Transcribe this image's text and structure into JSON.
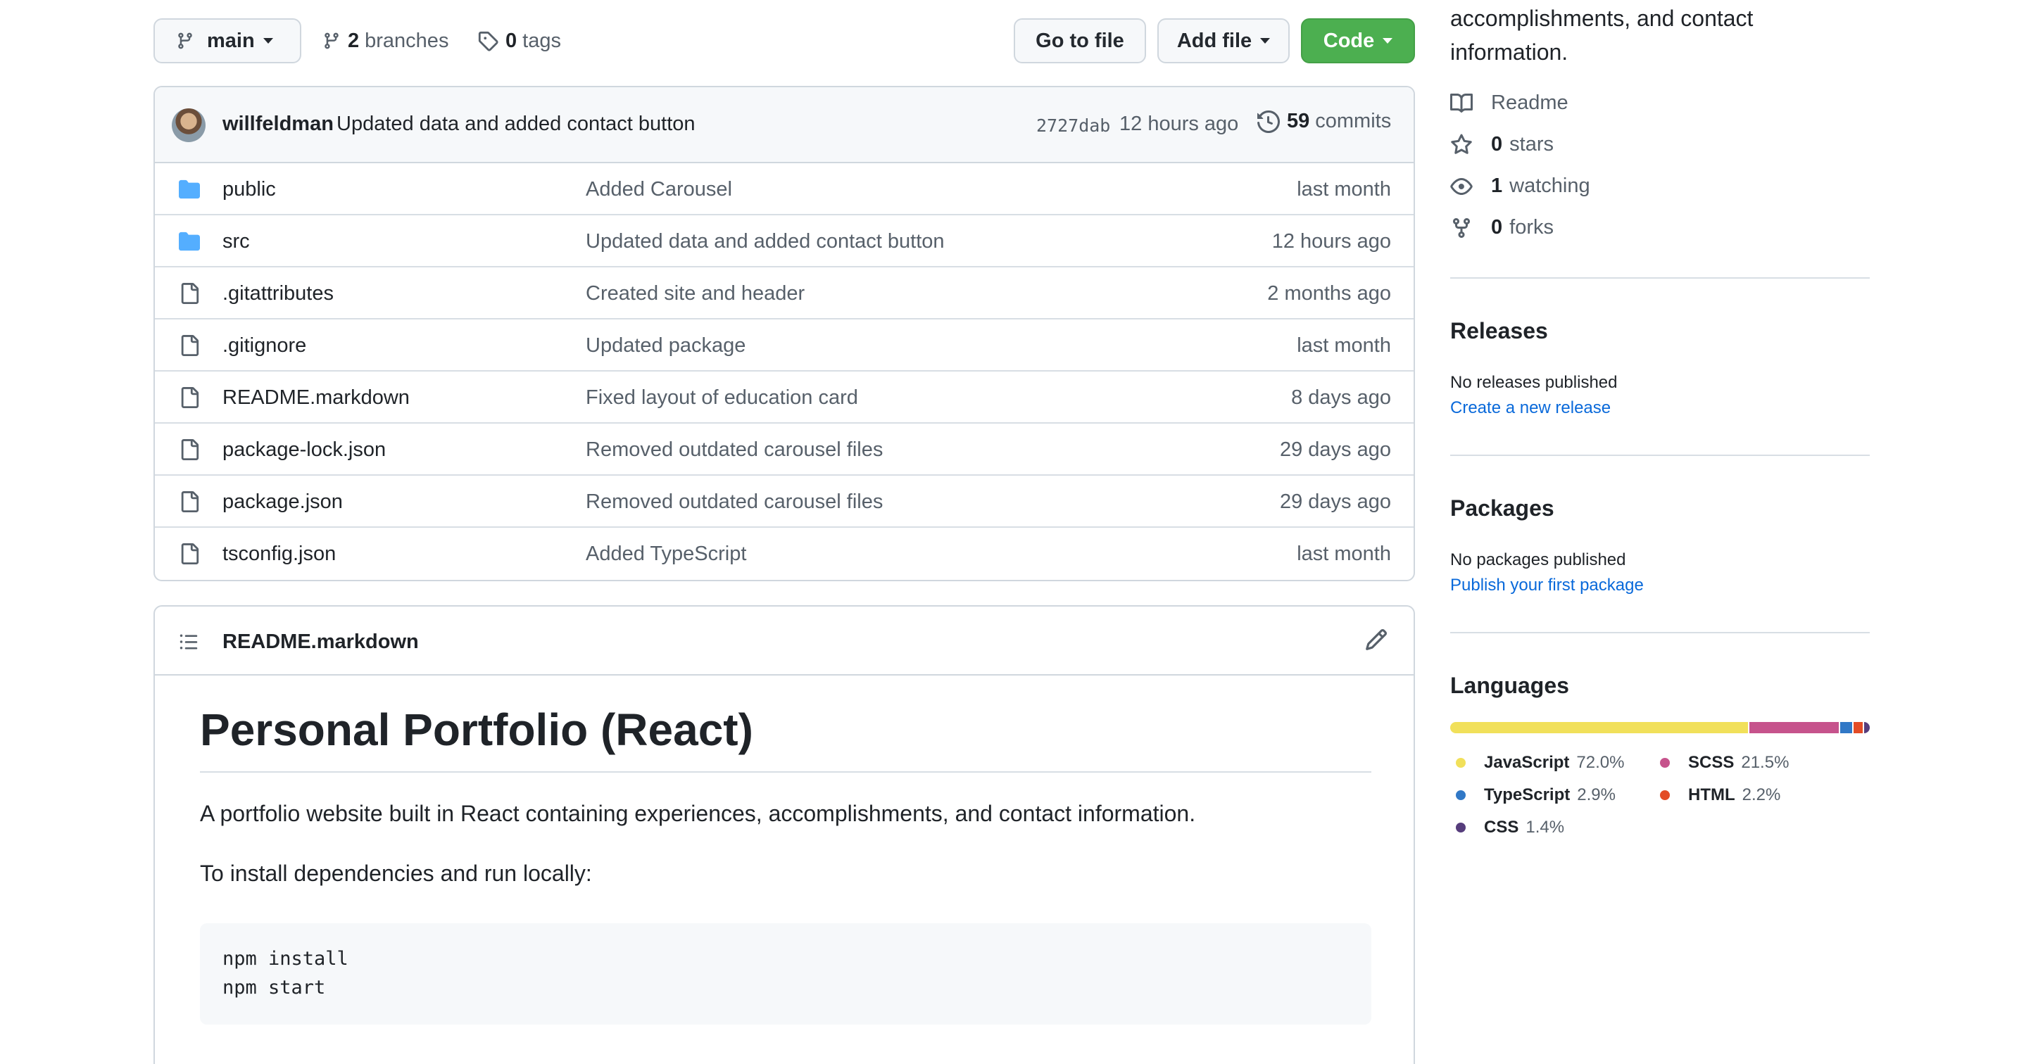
{
  "repo_bar": {
    "branch": "main",
    "branches_count": "2",
    "branches_label": "branches",
    "tags_count": "0",
    "tags_label": "tags",
    "goto_file": "Go to file",
    "add_file": "Add file",
    "code": "Code"
  },
  "latest_commit": {
    "author": "willfeldman",
    "message": "Updated data and added contact button",
    "sha": "2727dab",
    "time": "12 hours ago",
    "count": "59",
    "count_label": "commits"
  },
  "files": [
    {
      "name": "public",
      "type": "folder",
      "message": "Added Carousel",
      "age": "last month"
    },
    {
      "name": "src",
      "type": "folder",
      "message": "Updated data and added contact button",
      "age": "12 hours ago"
    },
    {
      "name": ".gitattributes",
      "type": "file",
      "message": "Created site and header",
      "age": "2 months ago"
    },
    {
      "name": ".gitignore",
      "type": "file",
      "message": "Updated package",
      "age": "last month"
    },
    {
      "name": "README.markdown",
      "type": "file",
      "message": "Fixed layout of education card",
      "age": "8 days ago"
    },
    {
      "name": "package-lock.json",
      "type": "file",
      "message": "Removed outdated carousel files",
      "age": "29 days ago"
    },
    {
      "name": "package.json",
      "type": "file",
      "message": "Removed outdated carousel files",
      "age": "29 days ago"
    },
    {
      "name": "tsconfig.json",
      "type": "file",
      "message": "Added TypeScript",
      "age": "last month"
    }
  ],
  "readme": {
    "filename": "README.markdown",
    "heading": "Personal Portfolio (React)",
    "paragraph1": "A portfolio website built in React containing experiences, accomplishments, and contact information.",
    "paragraph2": "To install dependencies and run locally:",
    "code_line1": "npm install",
    "code_line2": "npm start"
  },
  "sidebar": {
    "about_line1": "accomplishments, and contact",
    "about_line2": "information.",
    "readme_label": "Readme",
    "stars_count": "0",
    "stars_label": "stars",
    "watching_count": "1",
    "watching_label": "watching",
    "forks_count": "0",
    "forks_label": "forks",
    "releases_heading": "Releases",
    "releases_note": "No releases published",
    "releases_link": "Create a new release",
    "packages_heading": "Packages",
    "packages_note": "No packages published",
    "packages_link": "Publish your first package",
    "languages_heading": "Languages",
    "languages": [
      {
        "name": "JavaScript",
        "percent": "72.0%",
        "value": 72.0,
        "color": "#f1e05a"
      },
      {
        "name": "SCSS",
        "percent": "21.5%",
        "value": 21.5,
        "color": "#c6538c"
      },
      {
        "name": "TypeScript",
        "percent": "2.9%",
        "value": 2.9,
        "color": "#3178c6"
      },
      {
        "name": "HTML",
        "percent": "2.2%",
        "value": 2.2,
        "color": "#e34c26"
      },
      {
        "name": "CSS",
        "percent": "1.4%",
        "value": 1.4,
        "color": "#563d7c"
      }
    ]
  }
}
